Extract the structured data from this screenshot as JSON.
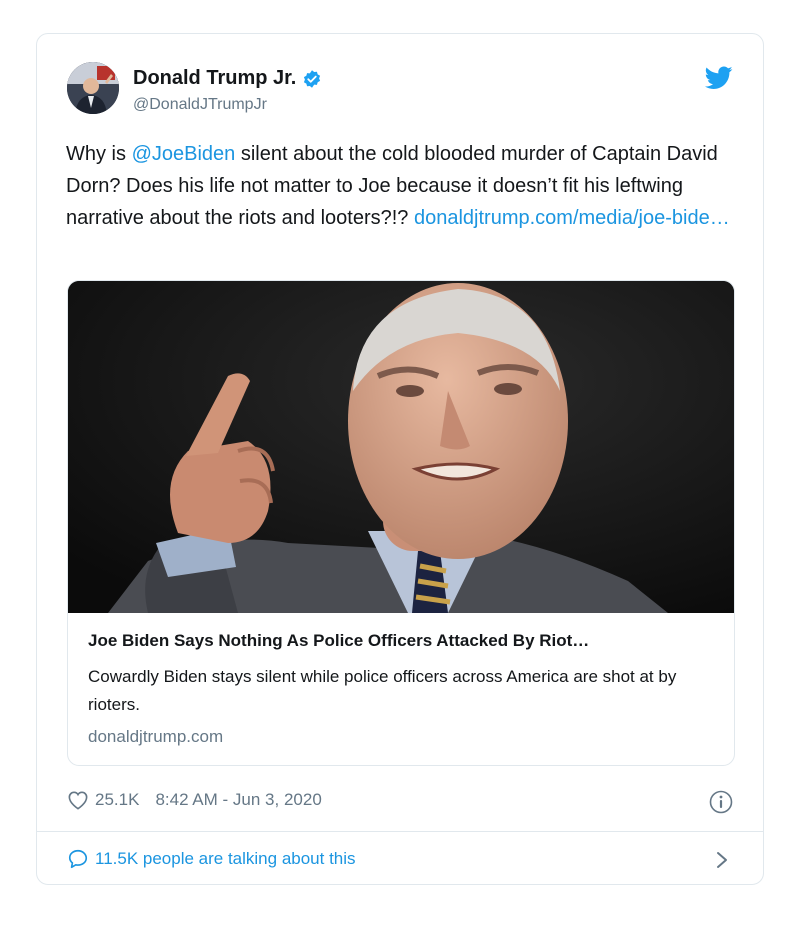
{
  "tweet": {
    "author_name": "Donald Trump Jr.",
    "handle": "@DonaldJTrumpJr",
    "text_prefix": "Why is ",
    "mention": "@JoeBiden",
    "text_body": " silent about the cold blooded murder of Captain David Dorn? Does his life not matter to Joe because it doesn’t fit his leftwing narrative about the riots and looters?!? ",
    "link": "donaldjtrump.com/media/joe-bide…"
  },
  "card": {
    "title": "Joe Biden Says Nothing As Police Officers Attacked By Riot…",
    "description": "Cowardly Biden stays silent while police officers across America are shot at by rioters.",
    "domain": "donaldjtrump.com"
  },
  "meta": {
    "likes": "25.1K",
    "timestamp": "8:42 AM - Jun 3, 2020"
  },
  "footer": {
    "talking": "11.5K people are talking about this"
  },
  "colors": {
    "link": "#1b95e0",
    "text": "#14171a",
    "secondary": "#657786",
    "border": "#e1e8ed"
  },
  "icons": [
    "verified-badge-icon",
    "twitter-bird-icon",
    "heart-icon",
    "info-icon",
    "speech-bubble-icon",
    "chevron-right-icon"
  ]
}
